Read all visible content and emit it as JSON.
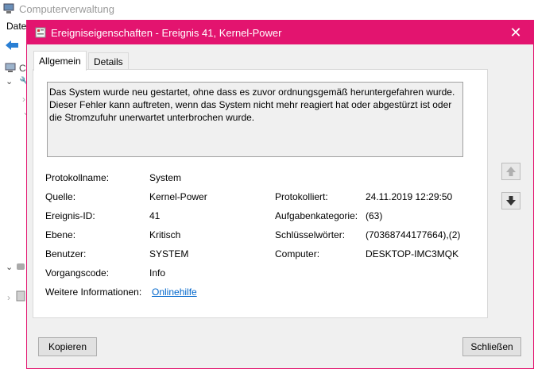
{
  "background_app": {
    "title": "Computerverwaltung",
    "menu_partial": "Date",
    "tree_partial": "C"
  },
  "dialog": {
    "title": "Ereigniseigenschaften - Ereignis 41, Kernel-Power",
    "close_glyph": "✕",
    "tabs": [
      {
        "label": "Allgemein",
        "active": true
      },
      {
        "label": "Details",
        "active": false
      }
    ],
    "description": "Das System wurde neu gestartet, ohne dass es zuvor ordnungsgemäß heruntergefahren wurde. Dieser Fehler kann auftreten, wenn das System nicht mehr reagiert hat oder abgestürzt ist oder die Stromzufuhr unerwartet unterbrochen wurde.",
    "fields": {
      "log_name": {
        "label": "Protokollname:",
        "value": "System"
      },
      "source": {
        "label": "Quelle:",
        "value": "Kernel-Power"
      },
      "logged": {
        "label": "Protokolliert:",
        "value": "24.11.2019 12:29:50"
      },
      "event_id": {
        "label": "Ereignis-ID:",
        "value": "41"
      },
      "task_category": {
        "label": "Aufgabenkategorie:",
        "value": "(63)"
      },
      "level": {
        "label": "Ebene:",
        "value": "Kritisch"
      },
      "keywords": {
        "label": "Schlüsselwörter:",
        "value": "(70368744177664),(2)"
      },
      "user": {
        "label": "Benutzer:",
        "value": "SYSTEM"
      },
      "computer": {
        "label": "Computer:",
        "value": "DESKTOP-IMC3MQK"
      },
      "opcode": {
        "label": "Vorgangscode:",
        "value": "Info"
      },
      "more_info": {
        "label": "Weitere Informationen:",
        "value": "Onlinehilfe"
      }
    },
    "buttons": {
      "copy": "Kopieren",
      "close": "Schließen"
    },
    "accent_color": "#e3146f"
  }
}
